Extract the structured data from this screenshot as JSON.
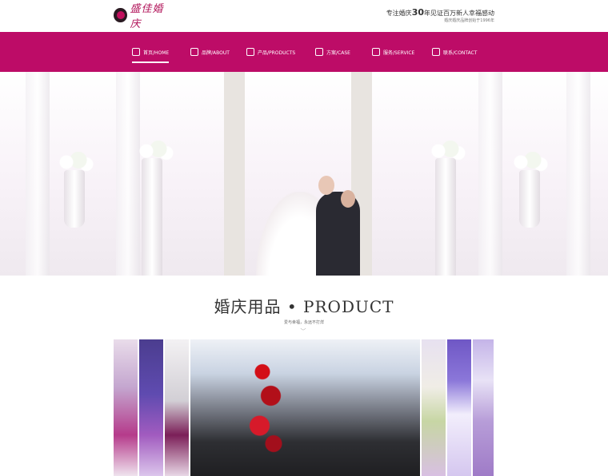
{
  "brand": {
    "logo_text": "盛佳婚庆",
    "slogan": {
      "prefix": "专注婚庆",
      "number": "30",
      "suffix": "年见证百万新人幸福感动",
      "sub": "婚庆婚庆品牌创始于1996年"
    }
  },
  "nav": {
    "items": [
      {
        "label": "首页/HOME",
        "icon": "home-icon"
      },
      {
        "label": "品牌/ABOUT",
        "icon": "about-icon"
      },
      {
        "label": "产品/PRODUCTS",
        "icon": "products-icon"
      },
      {
        "label": "方案/CASE",
        "icon": "case-icon"
      },
      {
        "label": "服务/SERVICE",
        "icon": "service-icon"
      },
      {
        "label": "联系/CONTACT",
        "icon": "contact-icon"
      }
    ]
  },
  "section": {
    "title": "婚庆用品 • PRODUCT",
    "subtitle": "爱与幸福，永远不打烊"
  },
  "colors": {
    "brand": "#bd0c67",
    "accent": "#c0105d"
  }
}
